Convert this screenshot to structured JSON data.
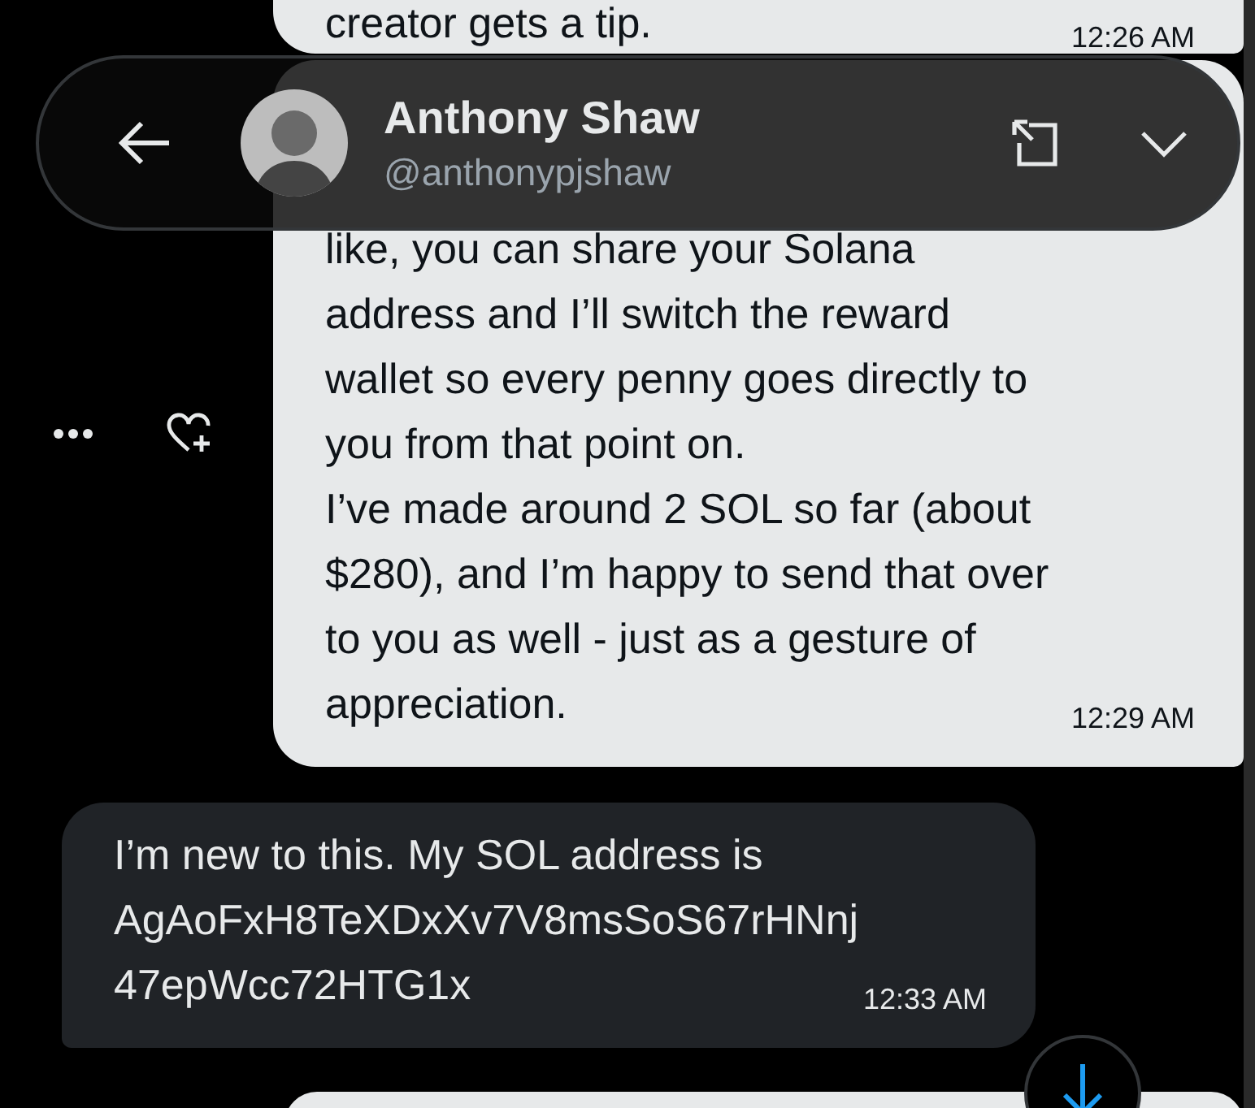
{
  "header": {
    "name": "Anthony Shaw",
    "handle": "@anthonypjshaw"
  },
  "messages": [
    {
      "kind": "sent",
      "lines": [
        "creator gets a tip."
      ],
      "time": "12:26 AM"
    },
    {
      "kind": "sent",
      "lines": [
        "like, you can share your Solana",
        "address and I’ll switch the reward",
        "wallet so every penny goes directly to",
        "you from that point on.",
        "I’ve made around 2 SOL so far (about",
        "$280), and I’m happy to send that over",
        "to you as well -  just as a gesture of",
        "appreciation."
      ],
      "time": "12:29 AM",
      "actions": true
    },
    {
      "kind": "received",
      "lines": [
        "I’m new to this. My SOL address is",
        "AgAoFxH8TeXDxXv7V8msSoS67rHNnj",
        "47epWcc72HTG1x"
      ],
      "time": "12:33 AM"
    }
  ]
}
